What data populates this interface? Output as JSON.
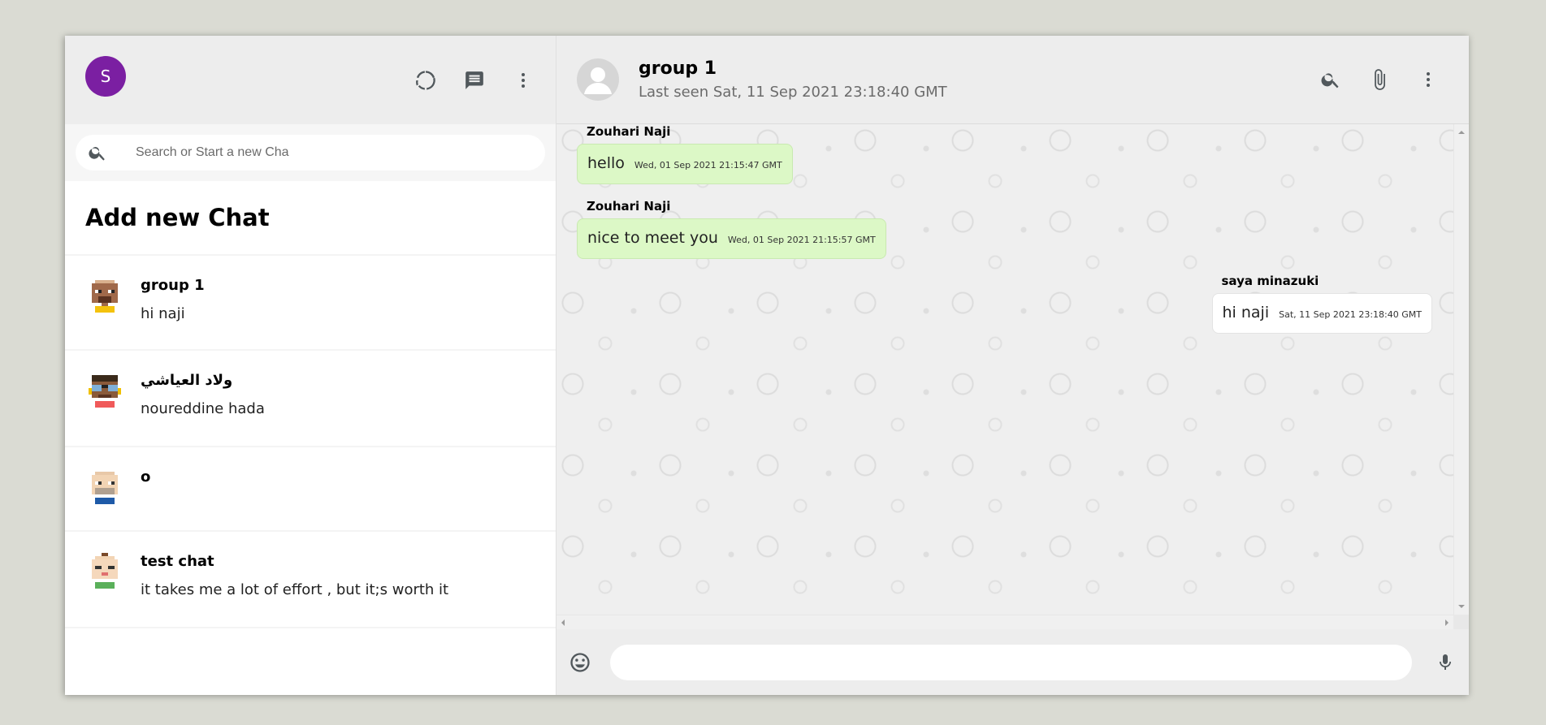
{
  "sidebar": {
    "user_avatar_letter": "S",
    "user_avatar_color": "#7b1fa2",
    "icons": [
      "status-icon",
      "chat-icon",
      "more-vert-icon"
    ],
    "search": {
      "placeholder": "Search or Start a new Cha",
      "value": ""
    },
    "add_new_chat": "Add new Chat",
    "chats": [
      {
        "name": "group 1",
        "last_message": "hi naji",
        "avatar": "pixel-avatar-brown"
      },
      {
        "name": "ولاد العياشي",
        "last_message": "noureddine hada",
        "avatar": "pixel-avatar-glasses"
      },
      {
        "name": "o",
        "last_message": "",
        "avatar": "pixel-avatar-bald"
      },
      {
        "name": "test chat",
        "last_message": "it takes me a lot of effort , but it;s worth it",
        "avatar": "pixel-avatar-baby"
      }
    ]
  },
  "chat": {
    "title": "group 1",
    "last_seen": "Last seen Sat, 11 Sep 2021 23:18:40 GMT",
    "header_icons": [
      "search-icon",
      "attach-icon",
      "more-vert-icon"
    ],
    "messages": [
      {
        "sender": "Zouhari Naji",
        "text": "hello",
        "time": "Wed, 01 Sep 2021 21:15:47 GMT",
        "own": true
      },
      {
        "sender": "Zouhari Naji",
        "text": "nice to meet you",
        "time": "Wed, 01 Sep 2021 21:15:57 GMT",
        "own": true
      },
      {
        "sender": "saya minazuki",
        "text": "hi naji",
        "time": "Sat, 11 Sep 2021 23:18:40 GMT",
        "own": false
      }
    ],
    "input": {
      "placeholder": "",
      "value": ""
    },
    "colors": {
      "own_bubble": "#dcf8c6",
      "other_bubble": "#ffffff"
    }
  }
}
